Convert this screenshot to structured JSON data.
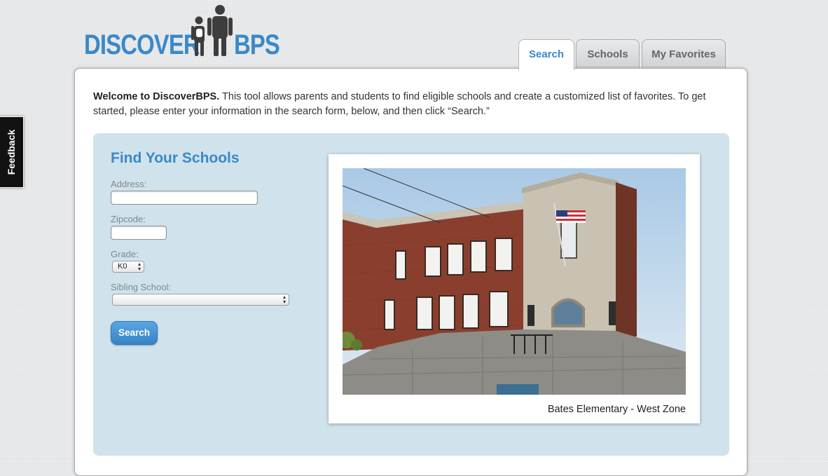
{
  "logo": {
    "word_left": "DISCOVER",
    "word_right": "BPS",
    "color": "#3a89c9",
    "figure_color": "#3d3d3d"
  },
  "tabs": [
    {
      "label": "Search",
      "active": true
    },
    {
      "label": "Schools",
      "active": false
    },
    {
      "label": "My Favorites",
      "active": false
    }
  ],
  "intro": {
    "bold": "Welcome to DiscoverBPS.",
    "text": " This tool allows parents and students to find eligible schools and create a customized list of favorites. To get started, please enter your information in the search form, below, and then click “Search.”"
  },
  "form": {
    "title": "Find Your Schools",
    "address": {
      "label": "Address:",
      "value": ""
    },
    "zipcode": {
      "label": "Zipcode:",
      "value": ""
    },
    "grade": {
      "label": "Grade:",
      "selected": "K0"
    },
    "sibling": {
      "label": "Sibling School:",
      "selected": ""
    },
    "search_button": "Search"
  },
  "photo": {
    "caption": "Bates Elementary - West Zone"
  },
  "feedback": {
    "label": "Feedback"
  },
  "colors": {
    "accent": "#3a89c9",
    "panel": "#d0e2eb",
    "button": "#3584c7"
  }
}
